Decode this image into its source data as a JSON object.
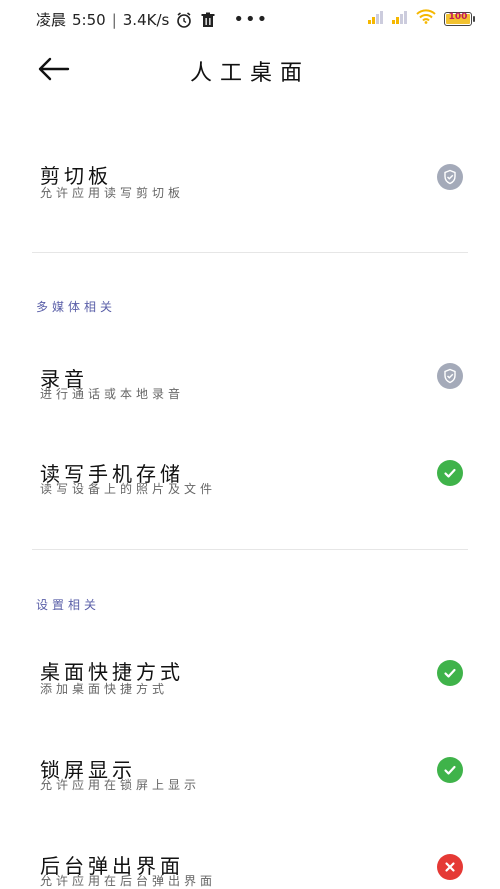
{
  "status_bar": {
    "carrier_text": "凌晨",
    "time": "5:50",
    "separator": "|",
    "speed": "3.4K/s",
    "battery_level": "100"
  },
  "header": {
    "title": "人工桌面"
  },
  "permissions": [
    {
      "title": "剪切板",
      "description": "允许应用读写剪切板",
      "status": "gray"
    },
    {
      "title": "录音",
      "description": "进行通话或本地录音",
      "status": "gray"
    },
    {
      "title": "读写手机存储",
      "description": "读写设备上的照片及文件",
      "status": "green"
    },
    {
      "title": "桌面快捷方式",
      "description": "添加桌面快捷方式",
      "status": "green"
    },
    {
      "title": "锁屏显示",
      "description": "允许应用在锁屏上显示",
      "status": "green"
    },
    {
      "title": "后台弹出界面",
      "description": "允许应用在后台弹出界面",
      "status": "red"
    }
  ],
  "sections": {
    "multimedia": "多媒体相关",
    "settings": "设置相关"
  },
  "colors": {
    "gray": "#a4aab9",
    "green": "#3fb34a",
    "red": "#e53935",
    "section": "#5a5fa8"
  }
}
